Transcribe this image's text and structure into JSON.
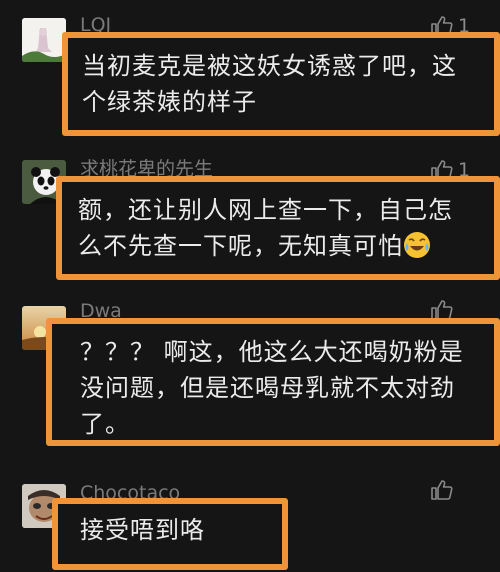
{
  "comments": [
    {
      "username": "LQJ",
      "likes": "1",
      "text": [
        "当初麦克是被这妖女诱惑了吧，这",
        "个绿茶婊的样子"
      ]
    },
    {
      "username": "求桃花卑的先生",
      "likes": "1",
      "text": [
        "额，还让别人网上查一下，自己怎",
        "么不先查一下呢，无知真可怕"
      ],
      "emoji": "laughing-crying-emoji"
    },
    {
      "username": "Dwa",
      "likes": "",
      "text": [
        "？？？ 啊这，他这么大还喝奶粉是",
        "没问题，但是还喝母乳就不太对劲",
        "了。"
      ]
    },
    {
      "username": "Chocotaco",
      "likes": "",
      "text": [
        "接受唔到咯"
      ]
    }
  ],
  "colors": {
    "background": "#151515",
    "highlight_border": "#f0943a",
    "comment_text": "#ebebeb",
    "username_text": "#7a7a7a"
  }
}
